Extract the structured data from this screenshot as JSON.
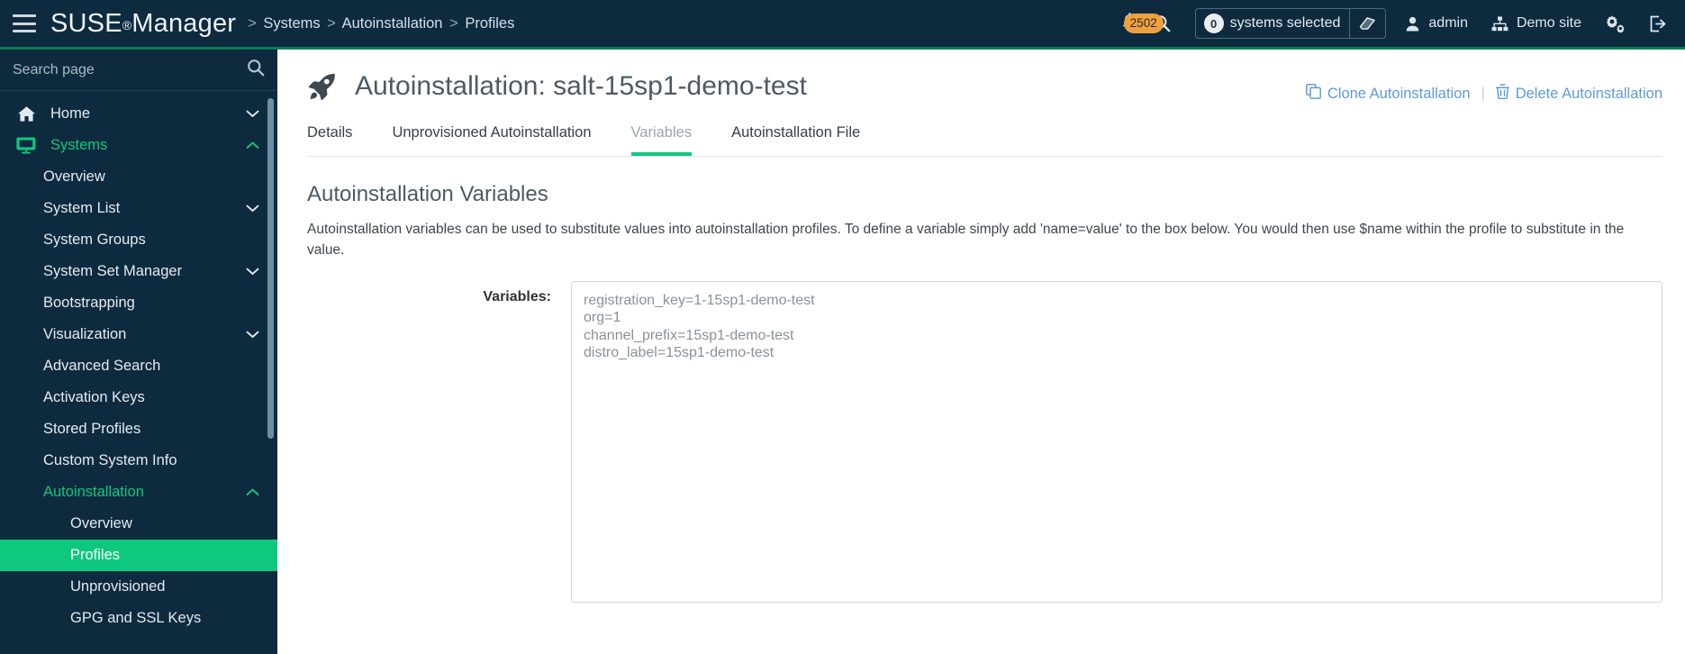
{
  "header": {
    "menu_icon": "hamburger-icon",
    "brand": "SUSE",
    "brand_reg": "®",
    "brand_suffix": "Manager",
    "breadcrumb": [
      {
        "label": "Systems"
      },
      {
        "label": "Autoinstallation"
      },
      {
        "label": "Profiles"
      }
    ],
    "breadcrumb_sep": ">",
    "notifications": {
      "icon": "bell-icon",
      "count": "2502",
      "badge_color": "#f0a03c"
    },
    "search_icon": "search-icon",
    "systems_selected": {
      "count": "0",
      "label": "systems selected",
      "clear_icon": "eraser-icon"
    },
    "user": {
      "icon": "user-icon",
      "label": "admin"
    },
    "site": {
      "icon": "sitemap-icon",
      "label": "Demo site"
    },
    "settings": {
      "icon": "gears-icon"
    },
    "signout": {
      "icon": "sign-out-icon"
    }
  },
  "sidebar": {
    "search": {
      "placeholder": "Search page",
      "value": "",
      "icon": "search-icon"
    },
    "items": [
      {
        "label": "Home",
        "level": 1,
        "icon": "home-icon",
        "chevron": "chevron-down",
        "state": ""
      },
      {
        "label": "Systems",
        "level": 1,
        "icon": "monitor-icon",
        "chevron": "chevron-up",
        "state": "open"
      },
      {
        "label": "Overview",
        "level": 2,
        "icon": "",
        "chevron": "",
        "state": ""
      },
      {
        "label": "System List",
        "level": 2,
        "icon": "",
        "chevron": "chevron-down",
        "state": ""
      },
      {
        "label": "System Groups",
        "level": 2,
        "icon": "",
        "chevron": "",
        "state": ""
      },
      {
        "label": "System Set Manager",
        "level": 2,
        "icon": "",
        "chevron": "chevron-down",
        "state": ""
      },
      {
        "label": "Bootstrapping",
        "level": 2,
        "icon": "",
        "chevron": "",
        "state": ""
      },
      {
        "label": "Visualization",
        "level": 2,
        "icon": "",
        "chevron": "chevron-down",
        "state": ""
      },
      {
        "label": "Advanced Search",
        "level": 2,
        "icon": "",
        "chevron": "",
        "state": ""
      },
      {
        "label": "Activation Keys",
        "level": 2,
        "icon": "",
        "chevron": "",
        "state": ""
      },
      {
        "label": "Stored Profiles",
        "level": 2,
        "icon": "",
        "chevron": "",
        "state": ""
      },
      {
        "label": "Custom System Info",
        "level": 2,
        "icon": "",
        "chevron": "",
        "state": ""
      },
      {
        "label": "Autoinstallation",
        "level": 2,
        "icon": "",
        "chevron": "chevron-up",
        "state": "open"
      },
      {
        "label": "Overview",
        "level": 3,
        "icon": "",
        "chevron": "",
        "state": ""
      },
      {
        "label": "Profiles",
        "level": 3,
        "icon": "",
        "chevron": "",
        "state": "active"
      },
      {
        "label": "Unprovisioned",
        "level": 3,
        "icon": "",
        "chevron": "",
        "state": ""
      },
      {
        "label": "GPG and SSL Keys",
        "level": 3,
        "icon": "",
        "chevron": "",
        "state": ""
      }
    ]
  },
  "page": {
    "icon": "rocket-icon",
    "title": "Autoinstallation: salt-15sp1-demo-test",
    "actions": [
      {
        "label": "Clone Autoinstallation",
        "icon": "clone-icon"
      },
      {
        "label": "Delete Autoinstallation",
        "icon": "trash-icon"
      }
    ],
    "action_divider": "|",
    "tabs": [
      {
        "label": "Details",
        "active": false
      },
      {
        "label": "Unprovisioned Autoinstallation",
        "active": false
      },
      {
        "label": "Variables",
        "active": true
      },
      {
        "label": "Autoinstallation File",
        "active": false
      }
    ],
    "section_title": "Autoinstallation Variables",
    "section_desc": "Autoinstallation variables can be used to substitute values into autoinstallation profiles. To define a variable simply add 'name=value' to the box below. You would then use $name within the profile to substitute in the value.",
    "form": {
      "variables_label": "Variables:",
      "variables_value": "registration_key=1-15sp1-demo-test\norg=1\nchannel_prefix=15sp1-demo-test\ndistro_label=15sp1-demo-test",
      "variables_placeholder": ""
    }
  },
  "colors": {
    "header_bg": "#0e2a3f",
    "accent_green": "#0fc77f",
    "badge_orange": "#f0a03c",
    "link_blue": "#5e9bd8"
  }
}
